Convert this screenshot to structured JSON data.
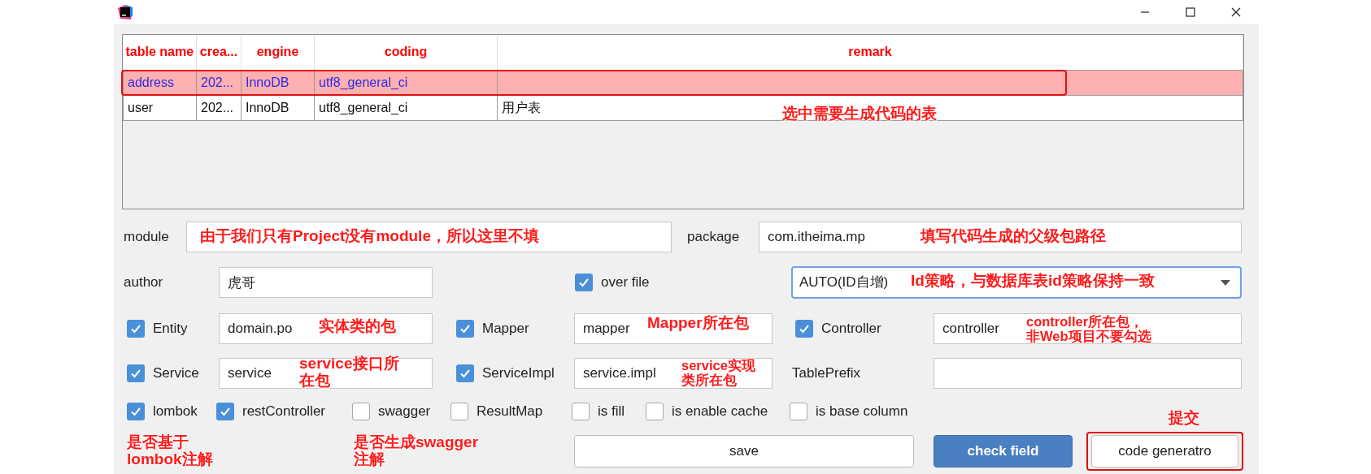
{
  "table": {
    "columns": [
      {
        "label": "table name"
      },
      {
        "label": "crea..."
      },
      {
        "label": "engine"
      },
      {
        "label": "coding"
      },
      {
        "label": "remark"
      }
    ],
    "rows": [
      {
        "cells": [
          "address",
          "202...",
          "InnoDB",
          "utf8_general_ci"
        ],
        "selected": true,
        "outlined": true
      },
      {
        "cells": [
          "user",
          "202...",
          "InnoDB",
          "utf8_general_ci",
          "用户表"
        ],
        "selected": false,
        "outlined": false
      }
    ]
  },
  "module": {
    "label": "module"
  },
  "package": {
    "label": "package",
    "value": "com.itheima.mp"
  },
  "author": {
    "label": "author",
    "value": "虎哥"
  },
  "over_file": {
    "label": "over file",
    "checked": true
  },
  "id_type": {
    "value": "AUTO(ID自增)"
  },
  "layer_rows": [
    [
      {
        "kind": "check",
        "label": "Entity",
        "checked": true,
        "value": "domain.po"
      },
      {
        "kind": "check",
        "label": "Mapper",
        "checked": true,
        "value": "mapper"
      },
      {
        "kind": "check",
        "label": "Controller",
        "checked": true,
        "value": "controller"
      }
    ],
    [
      {
        "kind": "check",
        "label": "Service",
        "checked": true,
        "value": "service"
      },
      {
        "kind": "check",
        "label": "ServiceImpl",
        "checked": true,
        "value": "service.impl"
      },
      {
        "kind": "label",
        "label": "TablePrefix"
      }
    ]
  ],
  "options": [
    {
      "label": "lombok",
      "checked": true
    },
    {
      "label": "restController",
      "checked": true
    },
    {
      "label": "swagger",
      "checked": false
    },
    {
      "label": "ResultMap",
      "checked": false
    },
    {
      "label": "is fill",
      "checked": false
    },
    {
      "label": "is enable cache",
      "checked": false
    },
    {
      "label": "is base column",
      "checked": false
    }
  ],
  "buttons": [
    {
      "label": "save",
      "kind": "default",
      "outlined": false
    },
    {
      "label": "check field",
      "kind": "primary",
      "outlined": false
    },
    {
      "label": "code generatro",
      "kind": "default",
      "outlined": true
    }
  ],
  "annotations": [
    {
      "lines": [
        "选中需要生成代码的表"
      ]
    },
    {
      "lines": [
        "由于我们只有Project没有module，所以这里不填"
      ]
    },
    {
      "lines": [
        "填写代码生成的父级包路径"
      ]
    },
    {
      "lines": [
        "Id策略，与数据库表id策略保持一致"
      ]
    },
    {
      "lines": [
        "实体类的包"
      ]
    },
    {
      "lines": [
        "Mapper所在包"
      ]
    },
    {
      "lines": [
        "controller所在包，",
        "非Web项目不要勾选"
      ]
    },
    {
      "lines": [
        "service接口所",
        "在包"
      ]
    },
    {
      "lines": [
        "service实现",
        "类所在包"
      ]
    },
    {
      "lines": [
        "是否基于",
        "lombok注解"
      ]
    },
    {
      "lines": [
        "是否生成swagger",
        "注解"
      ]
    },
    {
      "lines": [
        "提交"
      ]
    }
  ]
}
